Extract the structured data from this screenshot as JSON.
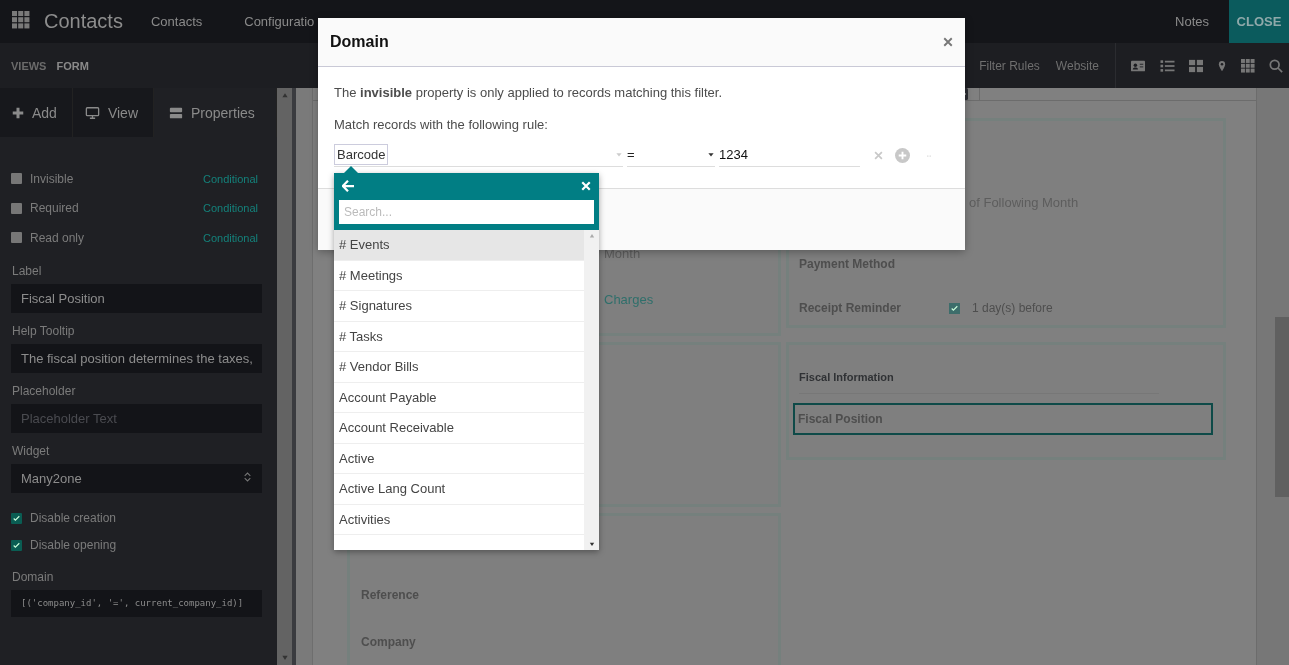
{
  "navbar": {
    "app_name": "Contacts",
    "menu": [
      {
        "label": "Contacts"
      },
      {
        "label": "Configuratio"
      }
    ],
    "notes": "Notes",
    "close": "CLOSE"
  },
  "subbar": {
    "breadcrumb": [
      "VIEWS",
      "FORM"
    ],
    "links": [
      "Filter Rules",
      "Website"
    ]
  },
  "sidebar": {
    "tabs": [
      {
        "label": "Add",
        "selected": false
      },
      {
        "label": "View",
        "selected": false
      },
      {
        "label": "Properties",
        "selected": true
      }
    ],
    "toggles": [
      {
        "label": "Invisible",
        "checked": false,
        "link": "Conditional"
      },
      {
        "label": "Required",
        "checked": false,
        "link": "Conditional"
      },
      {
        "label": "Read only",
        "checked": false,
        "link": "Conditional"
      }
    ],
    "fields": [
      {
        "kind": "text",
        "label": "Label",
        "value": "Fiscal Position"
      },
      {
        "kind": "text",
        "label": "Help Tooltip",
        "value": "The fiscal position determines the taxes,"
      },
      {
        "kind": "text",
        "label": "Placeholder",
        "placeholder": "Placeholder Text"
      },
      {
        "kind": "select",
        "label": "Widget",
        "value": "Many2one"
      }
    ],
    "options": [
      {
        "label": "Disable creation",
        "checked": true
      },
      {
        "label": "Disable opening",
        "checked": true
      }
    ],
    "domain": {
      "label": "Domain",
      "value": "[('company_id', '=', current_company_id)]"
    }
  },
  "form": {
    "left_fragments": [
      {
        "text": "Month",
        "kind": "plain"
      },
      {
        "text": "Charges",
        "kind": "link"
      }
    ],
    "right_fragment": "of Following Month",
    "right_rows": [
      {
        "label": "Payment Method"
      },
      {
        "label": "Receipt Reminder",
        "checked": true,
        "value": "1 day(s) before"
      }
    ],
    "fiscal": {
      "title": "Fiscal Information",
      "fields": [
        {
          "label": "Fiscal Position",
          "selected": true
        }
      ]
    },
    "bottom_labels": [
      "Reference",
      "Company"
    ]
  },
  "dialog": {
    "title": "Domain",
    "intro": "The **invisible** property is only applied to records matching this filter.",
    "rule_label": "Match records with the following rule:",
    "rule": {
      "field": "Barcode",
      "operator": "=",
      "value": "1234"
    },
    "field_picker": {
      "search_placeholder": "Search...",
      "items": [
        {
          "label": "# Events",
          "selected": true
        },
        {
          "label": "# Meetings",
          "selected": false
        },
        {
          "label": "# Signatures",
          "selected": false
        },
        {
          "label": "# Tasks",
          "selected": false
        },
        {
          "label": "# Vendor Bills",
          "selected": false
        },
        {
          "label": "Account Payable",
          "selected": false
        },
        {
          "label": "Account Receivable",
          "selected": false
        },
        {
          "label": "Active",
          "selected": false
        },
        {
          "label": "Active Lang Count",
          "selected": false
        },
        {
          "label": "Activities",
          "selected": false
        }
      ]
    }
  }
}
